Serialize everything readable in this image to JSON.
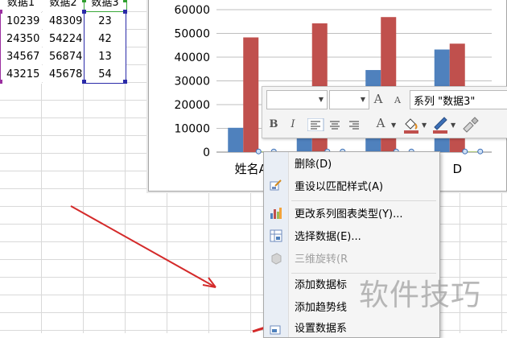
{
  "sheet": {
    "headers": [
      "数据1",
      "数据2",
      "数据3"
    ],
    "rows": [
      [
        "10239",
        "48309",
        "23"
      ],
      [
        "24350",
        "54224",
        "42"
      ],
      [
        "34567",
        "56874",
        "13"
      ],
      [
        "43215",
        "45678",
        "54"
      ]
    ]
  },
  "chart_data": {
    "type": "bar",
    "categories": [
      "姓名A",
      "",
      "",
      "D"
    ],
    "ylim": [
      0,
      60000
    ],
    "y_ticks": [
      "0",
      "10000",
      "20000",
      "30000",
      "40000",
      "50000",
      "60000"
    ],
    "series": [
      {
        "values": [
          10239,
          24350,
          34567,
          43215
        ],
        "color": "#4f81bd"
      },
      {
        "values": [
          48309,
          54224,
          56874,
          45678
        ],
        "color": "#c0504d"
      },
      {
        "values": [
          23,
          42,
          13,
          54
        ],
        "color": "#9bbb59"
      }
    ],
    "grid": true
  },
  "mini_toolbar": {
    "series_select": "系列 \"数据3\"",
    "font_grow": "A",
    "font_shrink": "A",
    "bold": "B",
    "italic": "I",
    "font_color": "A",
    "fill_color": "#c0504d",
    "line_color": "#c0504d"
  },
  "context_menu": {
    "items": [
      {
        "label": "删除(D)",
        "enabled": true
      },
      {
        "label": "重设以匹配样式(A)",
        "enabled": true
      },
      {
        "label": "更改系列图表类型(Y)...",
        "enabled": true
      },
      {
        "label": "选择数据(E)...",
        "enabled": true
      },
      {
        "label": "三维旋转(R",
        "enabled": false
      },
      {
        "label": "添加数据标",
        "enabled": true
      },
      {
        "label": "添加趋势线",
        "enabled": true
      },
      {
        "label": "设置数据系",
        "enabled": true
      }
    ]
  },
  "watermark": "软件技巧"
}
